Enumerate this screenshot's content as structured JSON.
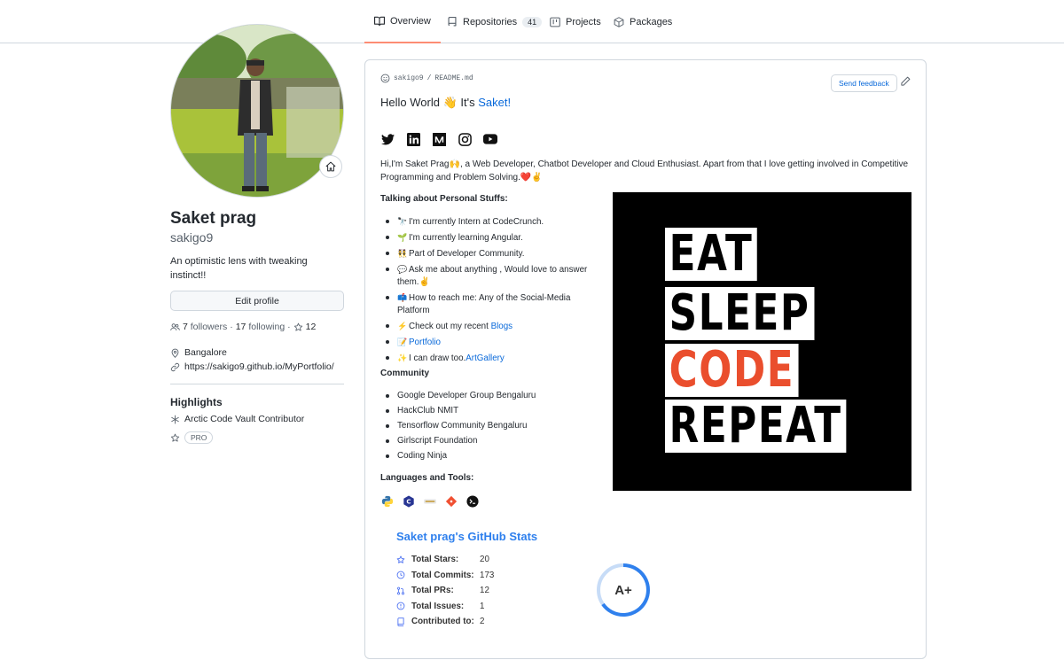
{
  "tabs": [
    {
      "label": "Overview",
      "active": true
    },
    {
      "label": "Repositories",
      "count": "41"
    },
    {
      "label": "Projects"
    },
    {
      "label": "Packages"
    }
  ],
  "profile": {
    "fullname": "Saket prag",
    "username": "sakigo9",
    "bio": "An optimistic lens with tweaking instinct!!",
    "edit_label": "Edit profile",
    "followers_count": "7",
    "followers_label": "followers",
    "following_count": "17",
    "following_label": "following",
    "stars": "12",
    "location": "Bangalore",
    "website": "https://sakigo9.github.io/MyPortfolio/",
    "highlights_title": "Highlights",
    "highlight_1": "Arctic Code Vault Contributor",
    "pro_badge": "PRO"
  },
  "readme": {
    "path_user": "sakigo9",
    "path_sep": "/",
    "path_file": "README.md",
    "feedback_label": "Send feedback",
    "hello_text": "Hello World 👋 It's",
    "hello_name": "Saket!",
    "intro": "Hi,I'm Saket Prag🙌, a Web Developer, Chatbot Developer and Cloud Enthusiast. Apart from that I love getting involved in Competitive Programming and Problem Solving.❤️✌️",
    "personal_title": "Talking about Personal Stuffs:",
    "personal_items": [
      {
        "emoji": "🔭",
        "text": "I'm currently Intern at CodeCrunch."
      },
      {
        "emoji": "🌱",
        "text": "I'm currently learning Angular."
      },
      {
        "emoji": "👯",
        "text": "Part of Developer Community."
      },
      {
        "emoji": "💬",
        "text": "Ask me about anything , Would love to answer them.✌️"
      },
      {
        "emoji": "📫",
        "text": "How to reach me: Any of the Social-Media Platform"
      },
      {
        "emoji": "⚡",
        "text": "Check out my recent",
        "link": "Blogs"
      },
      {
        "emoji": "📝",
        "text": "",
        "link": "Portfolio"
      },
      {
        "emoji": "✨",
        "text": "I can draw too.",
        "link": "ArtGallery"
      }
    ],
    "community_title": "Community",
    "community_items": [
      "Google Developer Group Bengaluru",
      "HackClub NMIT",
      "Tensorflow Community Bengaluru",
      "Girlscript Foundation",
      "Coding Ninja"
    ],
    "languages_title": "Languages and Tools:",
    "banner_lines": [
      "EAT",
      "SLEEP",
      "CODE",
      "REPEAT"
    ],
    "banner_accent": "#ea4e2d"
  },
  "stats": {
    "title": "Saket prag's GitHub Stats",
    "rows": [
      {
        "label": "Total Stars:",
        "value": "20"
      },
      {
        "label": "Total Commits:",
        "value": "173"
      },
      {
        "label": "Total PRs:",
        "value": "12"
      },
      {
        "label": "Total Issues:",
        "value": "1"
      },
      {
        "label": "Contributed to:",
        "value": "2"
      }
    ],
    "rank": "A+",
    "accent": "#2f80ed"
  }
}
